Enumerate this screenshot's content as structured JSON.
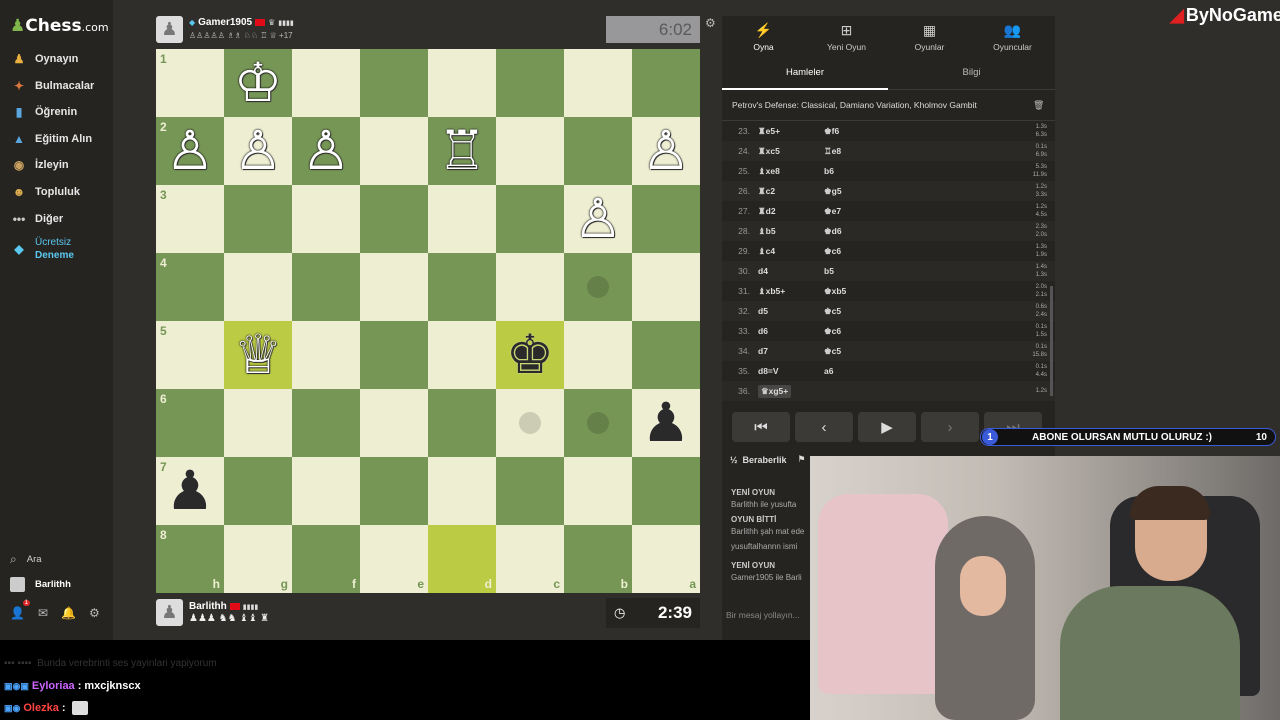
{
  "sidebar": {
    "logo": "Chess",
    "logo_domain": ".com",
    "items": [
      {
        "label": "Oynayın",
        "icon": "hand-pawn-icon",
        "color": "#e8b03d"
      },
      {
        "label": "Bulmacalar",
        "icon": "puzzle-icon",
        "color": "#d9773e"
      },
      {
        "label": "Öğrenin",
        "icon": "book-icon",
        "color": "#5aa7e0"
      },
      {
        "label": "Eğitim Alın",
        "icon": "graduation-cap-icon",
        "color": "#5aa7e0"
      },
      {
        "label": "İzleyin",
        "icon": "binoculars-icon",
        "color": "#c8a060"
      },
      {
        "label": "Topluluk",
        "icon": "community-icon",
        "color": "#e0b050"
      },
      {
        "label": "Diğer",
        "icon": "more-dots-icon",
        "color": "#ccc"
      },
      {
        "label": "Ücretsiz",
        "label2": "Deneme",
        "icon": "diamond-icon",
        "color": "#5ac8f0",
        "accent": true
      }
    ],
    "search": "Ara",
    "user": "Barlithh",
    "notif_count": "1"
  },
  "brand": {
    "name": "ByNoGame"
  },
  "top_player": {
    "name": "Gamer1905",
    "captured": "+17",
    "clock": "6:02"
  },
  "bottom_player": {
    "name": "Barlithh",
    "clock": "2:39"
  },
  "board": {
    "ranks": [
      "1",
      "2",
      "3",
      "4",
      "5",
      "6",
      "7",
      "8"
    ],
    "files": [
      "h",
      "g",
      "f",
      "e",
      "d",
      "c",
      "b",
      "a"
    ],
    "pieces": [
      {
        "r": 0,
        "c": 1,
        "p": "♔",
        "color": "w"
      },
      {
        "r": 1,
        "c": 0,
        "p": "♙",
        "color": "w"
      },
      {
        "r": 1,
        "c": 1,
        "p": "♙",
        "color": "w"
      },
      {
        "r": 1,
        "c": 2,
        "p": "♙",
        "color": "w"
      },
      {
        "r": 1,
        "c": 4,
        "p": "♖",
        "color": "w"
      },
      {
        "r": 1,
        "c": 7,
        "p": "♙",
        "color": "w"
      },
      {
        "r": 2,
        "c": 6,
        "p": "♙",
        "color": "w"
      },
      {
        "r": 4,
        "c": 1,
        "p": "♕",
        "color": "w"
      },
      {
        "r": 4,
        "c": 5,
        "p": "♚",
        "color": "b"
      },
      {
        "r": 5,
        "c": 7,
        "p": "♟",
        "color": "b"
      },
      {
        "r": 6,
        "c": 0,
        "p": "♟",
        "color": "b"
      }
    ],
    "highlights": [
      [
        4,
        1
      ],
      [
        4,
        5
      ],
      [
        7,
        4
      ]
    ],
    "dots": [
      [
        3,
        6
      ],
      [
        5,
        5
      ],
      [
        5,
        6
      ]
    ]
  },
  "panel": {
    "tabs": [
      "Oyna",
      "Yeni Oyun",
      "Oyunlar",
      "Oyuncular"
    ],
    "tab_icons": [
      "bolt-icon",
      "plus-square-icon",
      "board-grid-icon",
      "players-icon"
    ],
    "subtabs": [
      "Hamleler",
      "Bilgi"
    ],
    "opening": "Petrov's Defense: Classical, Damiano Variation, Kholmov Gambit",
    "moves": [
      [
        "23.",
        "♜",
        "e5+",
        "♚",
        "f6",
        "1.3s",
        "6.3s"
      ],
      [
        "24.",
        "♜",
        "xc5",
        "♖",
        "e8",
        "0.1s",
        "6.9s"
      ],
      [
        "25.",
        "♝",
        "xe8",
        "",
        "b6",
        "5.3s",
        "11.9s"
      ],
      [
        "26.",
        "♜",
        "c2",
        "♚",
        "g5",
        "1.2s",
        "3.3s"
      ],
      [
        "27.",
        "♜",
        "d2",
        "♚",
        "e7",
        "1.2s",
        "4.5s"
      ],
      [
        "28.",
        "♝",
        "b5",
        "♚",
        "d6",
        "2.3s",
        "2.0s"
      ],
      [
        "29.",
        "♝",
        "c4",
        "♚",
        "c6",
        "1.3s",
        "1.9s"
      ],
      [
        "30.",
        "",
        "d4",
        "",
        "b5",
        "1.4s",
        "1.3s"
      ],
      [
        "31.",
        "♝",
        "xb5+",
        "♚",
        "xb5",
        "2.0s",
        "2.1s"
      ],
      [
        "32.",
        "",
        "d5",
        "♚",
        "c5",
        "0.6s",
        "2.4s"
      ],
      [
        "33.",
        "",
        "d6",
        "♚",
        "c6",
        "0.1s",
        "1.5s"
      ],
      [
        "34.",
        "",
        "d7",
        "♚",
        "c5",
        "0.1s",
        "15.8s"
      ],
      [
        "35.",
        "",
        "d8=V",
        "",
        "a6",
        "0.1s",
        "4.4s"
      ],
      [
        "36.",
        "♛",
        "xg5+",
        "",
        "",
        "1.2s",
        ""
      ]
    ],
    "draw_label": "Beraberlik",
    "chat": [
      [
        "YENİ OYUN",
        "Barlithh ile yusufta"
      ],
      [
        "OYUN BİTTİ",
        "Barlithh şah mat ede"
      ],
      [
        "",
        "yusuftalhannn ismi"
      ],
      [
        "YENİ OYUN",
        "Gamer1905 ile Barli"
      ]
    ],
    "chat_placeholder": "Bir mesaj yollayın..."
  },
  "banner": {
    "level": "1",
    "text": "ABONE OLURSAN MUTLU OLURUZ :)",
    "count": "10"
  },
  "chatlog": [
    {
      "user": "Eyloriaa",
      "msg": "mxcjknscx",
      "color": "#cc66ff"
    },
    {
      "user": "Olezka",
      "msg": "",
      "color": "#ff4444"
    }
  ],
  "chatlog_faded": "Bunda verebrinti ses yayinlari yapiyorum"
}
